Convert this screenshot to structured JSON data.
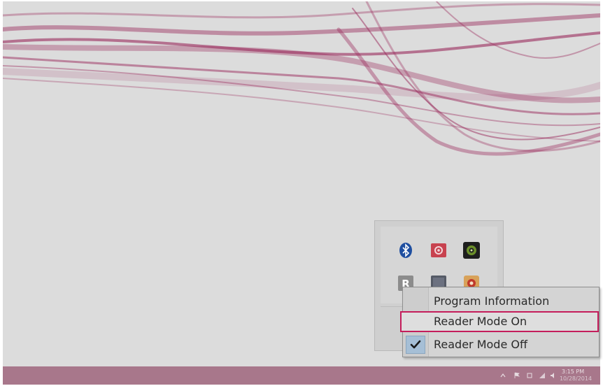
{
  "context_menu": {
    "items": [
      {
        "label": "Program Information",
        "checked": false
      },
      {
        "label": "Reader Mode On",
        "checked": false,
        "highlighted": true
      },
      {
        "label": "Reader Mode Off",
        "checked": true
      }
    ]
  },
  "tray_popup": {
    "icons": [
      "bluetooth-icon",
      "settings-app-icon",
      "camera-app-icon",
      "reader-app-icon",
      "display-app-icon",
      "media-app-icon"
    ]
  },
  "taskbar": {
    "clock_time": "3:15 PM",
    "clock_date": "10/28/2014"
  },
  "colors": {
    "accent_highlight": "#c41d5b",
    "taskbar": "#a8778b",
    "wallpaper_ribbon": "#9a2a5c"
  }
}
